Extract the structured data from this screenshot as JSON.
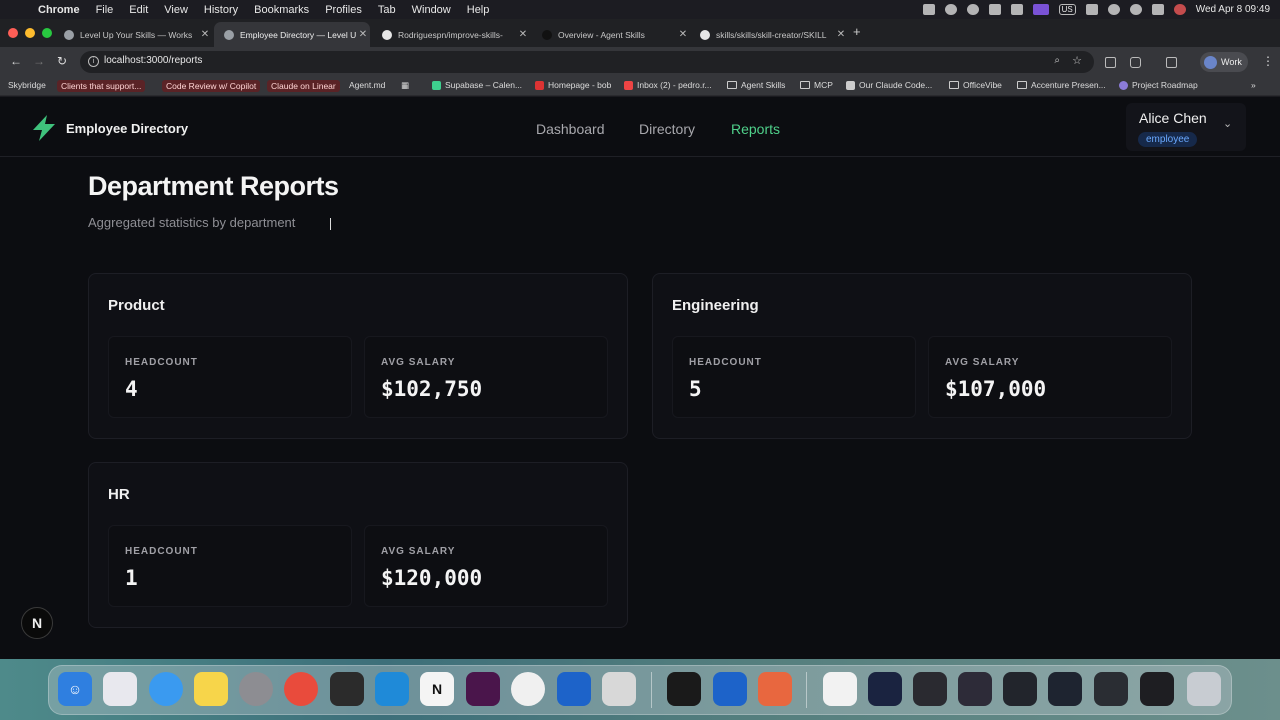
{
  "menubar": {
    "app": "Chrome",
    "items": [
      "File",
      "Edit",
      "View",
      "History",
      "Bookmarks",
      "Profiles",
      "Tab",
      "Window",
      "Help"
    ],
    "input_source": "US",
    "clock": "Wed Apr 8  09:49"
  },
  "tabs": [
    {
      "title": "Level Up Your Skills — Works",
      "active": false
    },
    {
      "title": "Employee Directory — Level U",
      "active": true
    },
    {
      "title": "Rodriguespn/improve-skills-",
      "active": false
    },
    {
      "title": "Overview - Agent Skills",
      "active": false
    },
    {
      "title": "skills/skills/skill-creator/SKILL",
      "active": false
    }
  ],
  "toolbar": {
    "url": "localhost:3000/reports",
    "profile_label": "Work"
  },
  "bookmarks": [
    {
      "label": "Skybridge",
      "chip": false
    },
    {
      "label": "Clients that support...",
      "chip": true
    },
    {
      "label": "Code Review w/ Copilot",
      "chip": true
    },
    {
      "label": "Claude on Linear",
      "chip": true
    },
    {
      "label": "Agent.md",
      "chip": false
    },
    {
      "label": "Supabase – Calen...",
      "chip": false
    },
    {
      "label": "Homepage - bob",
      "chip": false
    },
    {
      "label": "Inbox (2) - pedro.r...",
      "chip": false
    },
    {
      "label": "Agent Skills",
      "chip": false
    },
    {
      "label": "MCP",
      "chip": false
    },
    {
      "label": "Our Claude Code...",
      "chip": false
    },
    {
      "label": "OfficeVibe",
      "chip": false
    },
    {
      "label": "Accenture Presen...",
      "chip": false
    },
    {
      "label": "Project Roadmap",
      "chip": false
    }
  ],
  "app": {
    "brand": "Employee Directory",
    "nav": [
      "Dashboard",
      "Directory",
      "Reports"
    ],
    "active_nav": "Reports",
    "user": {
      "name": "Alice Chen",
      "role": "employee"
    },
    "accent_color": "#4fd08a"
  },
  "page": {
    "title": "Department Reports",
    "subtitle": "Aggregated statistics by department"
  },
  "departments": [
    {
      "name": "Product",
      "headcount_label": "HEADCOUNT",
      "headcount": "4",
      "salary_label": "AVG SALARY",
      "avg_salary": "$102,750"
    },
    {
      "name": "Engineering",
      "headcount_label": "HEADCOUNT",
      "headcount": "5",
      "salary_label": "AVG SALARY",
      "avg_salary": "$107,000"
    },
    {
      "name": "HR",
      "headcount_label": "HEADCOUNT",
      "headcount": "1",
      "salary_label": "AVG SALARY",
      "avg_salary": "$120,000"
    }
  ],
  "dev_badge": "N"
}
